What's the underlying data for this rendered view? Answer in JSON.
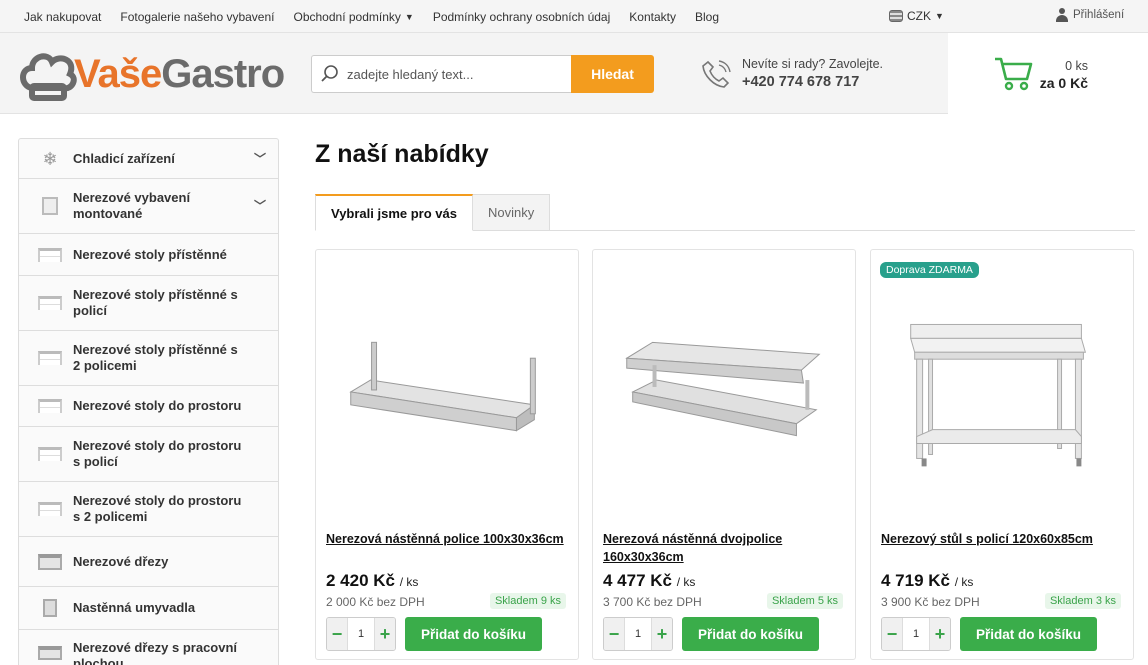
{
  "topbar": {
    "links": [
      {
        "label": "Jak nakupovat",
        "has_caret": false
      },
      {
        "label": "Fotogalerie našeho vybavení",
        "has_caret": false
      },
      {
        "label": "Obchodní podmínky",
        "has_caret": true
      },
      {
        "label": "Podmínky ochrany osobních údaj",
        "has_caret": false
      },
      {
        "label": "Kontakty",
        "has_caret": false
      },
      {
        "label": "Blog",
        "has_caret": false
      }
    ],
    "currency": "CZK",
    "login": "Přihlášení"
  },
  "header": {
    "logo_part1": "Vaše",
    "logo_part2": "Gastro",
    "search_placeholder": "zadejte hledaný text...",
    "search_button": "Hledat",
    "phone_question": "Nevíte si rady? Zavolejte.",
    "phone_number": "+420 774 678 717",
    "cart_count": "0 ks",
    "cart_total": "za 0 Kč"
  },
  "sidebar": {
    "items": [
      {
        "label": "Chladicí zařízení",
        "icon": "snowflake-icon",
        "expandable": true
      },
      {
        "label": "Nerezové vybavení montované",
        "icon": "cabinet-icon",
        "expandable": true
      },
      {
        "label": "Nerezové stoly přístěnné",
        "icon": "table-icon",
        "expandable": false
      },
      {
        "label": "Nerezové stoly přístěnné s policí",
        "icon": "table-icon",
        "expandable": false
      },
      {
        "label": "Nerezové stoly přístěnné s 2 policemi",
        "icon": "table-icon",
        "expandable": false
      },
      {
        "label": "Nerezové stoly do prostoru",
        "icon": "table-icon",
        "expandable": false
      },
      {
        "label": "Nerezové stoly do prostoru s policí",
        "icon": "table-icon",
        "expandable": false
      },
      {
        "label": "Nerezové stoly do prostoru s 2 policemi",
        "icon": "table-icon",
        "expandable": false
      },
      {
        "label": "Nerezové dřezy",
        "icon": "sink-icon",
        "expandable": false
      },
      {
        "label": "Nastěnná umyvadla",
        "icon": "washbasin-icon",
        "expandable": false
      },
      {
        "label": "Nerezové dřezy s pracovní plochou",
        "icon": "sink-icon",
        "expandable": false
      }
    ]
  },
  "main": {
    "title": "Z naší nabídky",
    "tabs": [
      {
        "label": "Vybrali jsme pro vás",
        "active": true
      },
      {
        "label": "Novinky",
        "active": false
      }
    ],
    "products": [
      {
        "name": "Nerezová nástěnná police 100x30x36cm",
        "price": "2 420 Kč",
        "unit": "/ ks",
        "netto": "2 000 Kč bez DPH",
        "stock": "Skladem 9 ks",
        "qty": "1",
        "add": "Přidat do košíku",
        "badge": ""
      },
      {
        "name": "Nerezová nástěnná dvojpolice 160x30x36cm",
        "price": "4 477 Kč",
        "unit": "/ ks",
        "netto": "3 700 Kč bez DPH",
        "stock": "Skladem 5 ks",
        "qty": "1",
        "add": "Přidat do košíku",
        "badge": ""
      },
      {
        "name": "Nerezový stůl s policí 120x60x85cm",
        "price": "4 719 Kč",
        "unit": "/ ks",
        "netto": "3 900 Kč bez DPH",
        "stock": "Skladem 3 ks",
        "qty": "1",
        "add": "Přidat do košíku",
        "badge": "Doprava ZDARMA"
      }
    ]
  },
  "colors": {
    "accent_orange": "#f39c1e",
    "green": "#3aad4a",
    "badge_teal": "#28a08c"
  }
}
